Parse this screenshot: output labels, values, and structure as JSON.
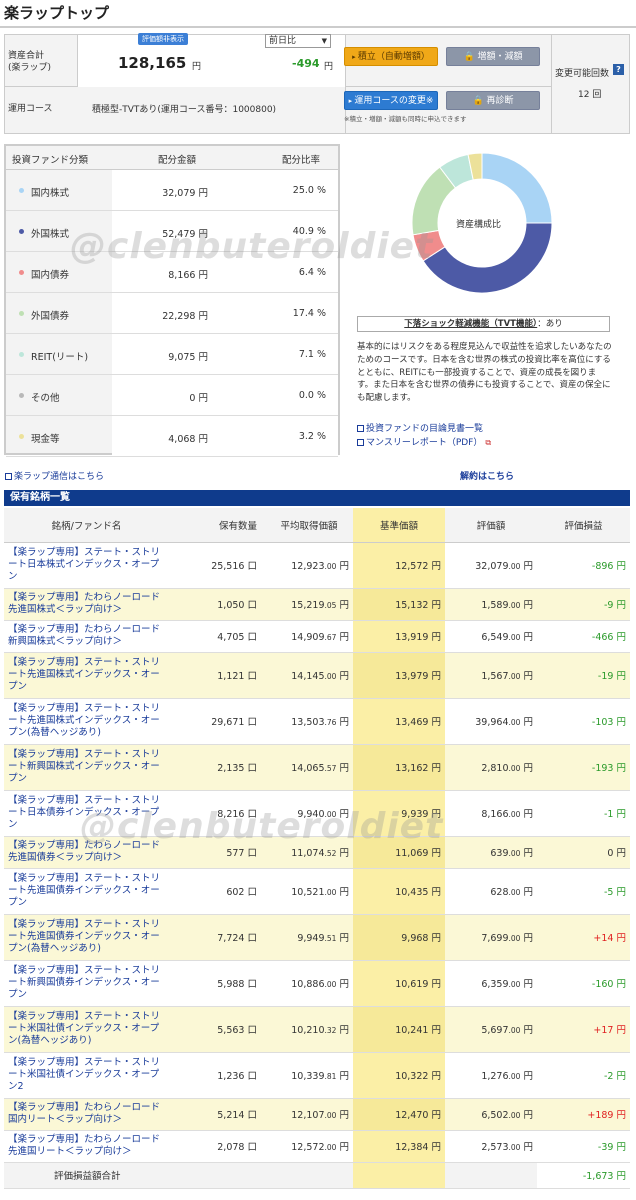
{
  "page_title": "楽ラップトップ",
  "summary": {
    "asset_label_1": "資産合計",
    "asset_label_2": "(楽ラップ)",
    "mask_badge": "評価額非表示",
    "total": "128,165",
    "yen": "円",
    "compare_select": "前日比",
    "diff": "-494",
    "course_label": "運用コース",
    "course_value": "積極型-TVTあり(運用コース番号：1000800)",
    "btn_reserve": "積立（自動増額）",
    "btn_change_amount": "増額・減額",
    "btn_change_course": "運用コースの変更※",
    "btn_rediagnose": "再診断",
    "note": "※積立・増額・減額も同時に申込できます",
    "changeable_label": "変更可能回数",
    "changeable_value": "12 回"
  },
  "fund_table": {
    "headers": [
      "投資ファンド分類",
      "配分金額",
      "配分比率"
    ],
    "rows": [
      {
        "name": "国内株式",
        "amount": "32,079",
        "pct": "25.0 %",
        "color": "#a9d4f5"
      },
      {
        "name": "外国株式",
        "amount": "52,479",
        "pct": "40.9 %",
        "color": "#4d5aa6"
      },
      {
        "name": "国内債券",
        "amount": "8,166",
        "pct": "6.4 %",
        "color": "#f08c8c"
      },
      {
        "name": "外国債券",
        "amount": "22,298",
        "pct": "17.4 %",
        "color": "#bfe0b4"
      },
      {
        "name": "REIT(リート)",
        "amount": "9,075",
        "pct": "7.1 %",
        "color": "#bde6da"
      },
      {
        "name": "その他",
        "amount": "0",
        "pct": "0.0 %",
        "color": "#b8b8b8"
      },
      {
        "name": "現金等",
        "amount": "4,068",
        "pct": "3.2 %",
        "color": "#ece19a"
      }
    ],
    "yen": "円"
  },
  "chart_data": {
    "type": "pie",
    "title": "資産構成比",
    "categories": [
      "国内株式",
      "外国株式",
      "国内債券",
      "外国債券",
      "REIT(リート)",
      "その他",
      "現金等"
    ],
    "values": [
      25.0,
      40.9,
      6.4,
      17.4,
      7.1,
      0.0,
      3.2
    ],
    "colors": [
      "#a9d4f5",
      "#4d5aa6",
      "#f08c8c",
      "#bfe0b4",
      "#bde6da",
      "#b8b8b8",
      "#ece19a"
    ]
  },
  "tvt": {
    "label": "下落ショック軽減機能（TVT機能）",
    "value": "：あり"
  },
  "description": "基本的にはリスクをある程度見込んで収益性を追求したいあなたのためのコースです。日本を含む世界の株式の投資比率を高位にするとともに、REITにも一部投資することで、資産の成長を図ります。また日本を含む世界の債券にも投資することで、資産の保全にも配慮します。",
  "links": {
    "prospectus": "投資ファンドの目論見書一覧",
    "monthly": "マンスリーレポート（PDF）",
    "newsletter": "楽ラップ通信はこちら",
    "cancel": "解約はこちら"
  },
  "holdings": {
    "section_title": "保有銘柄一覧",
    "headers": [
      "銘柄/ファンド名",
      "保有数量",
      "平均取得価額",
      "基準価額",
      "評価額",
      "評価損益"
    ],
    "unit_qty": "口",
    "unit_yen": "円",
    "rows": [
      {
        "name": "【楽ラップ専用】ステート・ストリート日本株式インデックス・オープン",
        "qty": "25,516",
        "avg_int": "12,923",
        "avg_dec": ".00",
        "base": "12,572",
        "val_int": "32,079",
        "val_dec": ".00",
        "pl": "-896",
        "sign": "neg"
      },
      {
        "name": "【楽ラップ専用】たわらノーロード先進国株式＜ラップ向け＞",
        "qty": "1,050",
        "avg_int": "15,219",
        "avg_dec": ".05",
        "base": "15,132",
        "val_int": "1,589",
        "val_dec": ".00",
        "pl": "-9",
        "sign": "neg"
      },
      {
        "name": "【楽ラップ専用】たわらノーロード新興国株式＜ラップ向け＞",
        "qty": "4,705",
        "avg_int": "14,909",
        "avg_dec": ".67",
        "base": "13,919",
        "val_int": "6,549",
        "val_dec": ".00",
        "pl": "-466",
        "sign": "neg"
      },
      {
        "name": "【楽ラップ専用】ステート・ストリート先進国株式インデックス・オープン",
        "qty": "1,121",
        "avg_int": "14,145",
        "avg_dec": ".00",
        "base": "13,979",
        "val_int": "1,567",
        "val_dec": ".00",
        "pl": "-19",
        "sign": "neg"
      },
      {
        "name": "【楽ラップ専用】ステート・ストリート先進国株式インデックス・オープン(為替ヘッジあり)",
        "qty": "29,671",
        "avg_int": "13,503",
        "avg_dec": ".76",
        "base": "13,469",
        "val_int": "39,964",
        "val_dec": ".00",
        "pl": "-103",
        "sign": "neg"
      },
      {
        "name": "【楽ラップ専用】ステート・ストリート新興国株式インデックス・オープン",
        "qty": "2,135",
        "avg_int": "14,065",
        "avg_dec": ".57",
        "base": "13,162",
        "val_int": "2,810",
        "val_dec": ".00",
        "pl": "-193",
        "sign": "neg"
      },
      {
        "name": "【楽ラップ専用】ステート・ストリート日本債券インデックス・オープン",
        "qty": "8,216",
        "avg_int": "9,940",
        "avg_dec": ".00",
        "base": "9,939",
        "val_int": "8,166",
        "val_dec": ".00",
        "pl": "-1",
        "sign": "neg"
      },
      {
        "name": "【楽ラップ専用】たわらノーロード先進国債券＜ラップ向け＞",
        "qty": "577",
        "avg_int": "11,074",
        "avg_dec": ".52",
        "base": "11,069",
        "val_int": "639",
        "val_dec": ".00",
        "pl": "0",
        "sign": "zero"
      },
      {
        "name": "【楽ラップ専用】ステート・ストリート先進国債券インデックス・オープン",
        "qty": "602",
        "avg_int": "10,521",
        "avg_dec": ".00",
        "base": "10,435",
        "val_int": "628",
        "val_dec": ".00",
        "pl": "-5",
        "sign": "neg"
      },
      {
        "name": "【楽ラップ専用】ステート・ストリート先進国債券インデックス・オープン(為替ヘッジあり)",
        "qty": "7,724",
        "avg_int": "9,949",
        "avg_dec": ".51",
        "base": "9,968",
        "val_int": "7,699",
        "val_dec": ".00",
        "pl": "+14",
        "sign": "pos"
      },
      {
        "name": "【楽ラップ専用】ステート・ストリート新興国債券インデックス・オープン",
        "qty": "5,988",
        "avg_int": "10,886",
        "avg_dec": ".00",
        "base": "10,619",
        "val_int": "6,359",
        "val_dec": ".00",
        "pl": "-160",
        "sign": "neg"
      },
      {
        "name": "【楽ラップ専用】ステート・ストリート米国社債インデックス・オープン(為替ヘッジあり)",
        "qty": "5,563",
        "avg_int": "10,210",
        "avg_dec": ".32",
        "base": "10,241",
        "val_int": "5,697",
        "val_dec": ".00",
        "pl": "+17",
        "sign": "pos"
      },
      {
        "name": "【楽ラップ専用】ステート・ストリート米国社債インデックス・オープン2",
        "qty": "1,236",
        "avg_int": "10,339",
        "avg_dec": ".81",
        "base": "10,322",
        "val_int": "1,276",
        "val_dec": ".00",
        "pl": "-2",
        "sign": "neg"
      },
      {
        "name": "【楽ラップ専用】たわらノーロード国内リート＜ラップ向け＞",
        "qty": "5,214",
        "avg_int": "12,107",
        "avg_dec": ".00",
        "base": "12,470",
        "val_int": "6,502",
        "val_dec": ".00",
        "pl": "+189",
        "sign": "pos"
      },
      {
        "name": "【楽ラップ専用】たわらノーロード先進国リート＜ラップ向け＞",
        "qty": "2,078",
        "avg_int": "12,572",
        "avg_dec": ".00",
        "base": "12,384",
        "val_int": "2,573",
        "val_dec": ".00",
        "pl": "-39",
        "sign": "neg"
      }
    ],
    "total_label": "評価損益額合計",
    "total_value": "-1,673"
  },
  "watermark": "@clenbuteroldiet"
}
